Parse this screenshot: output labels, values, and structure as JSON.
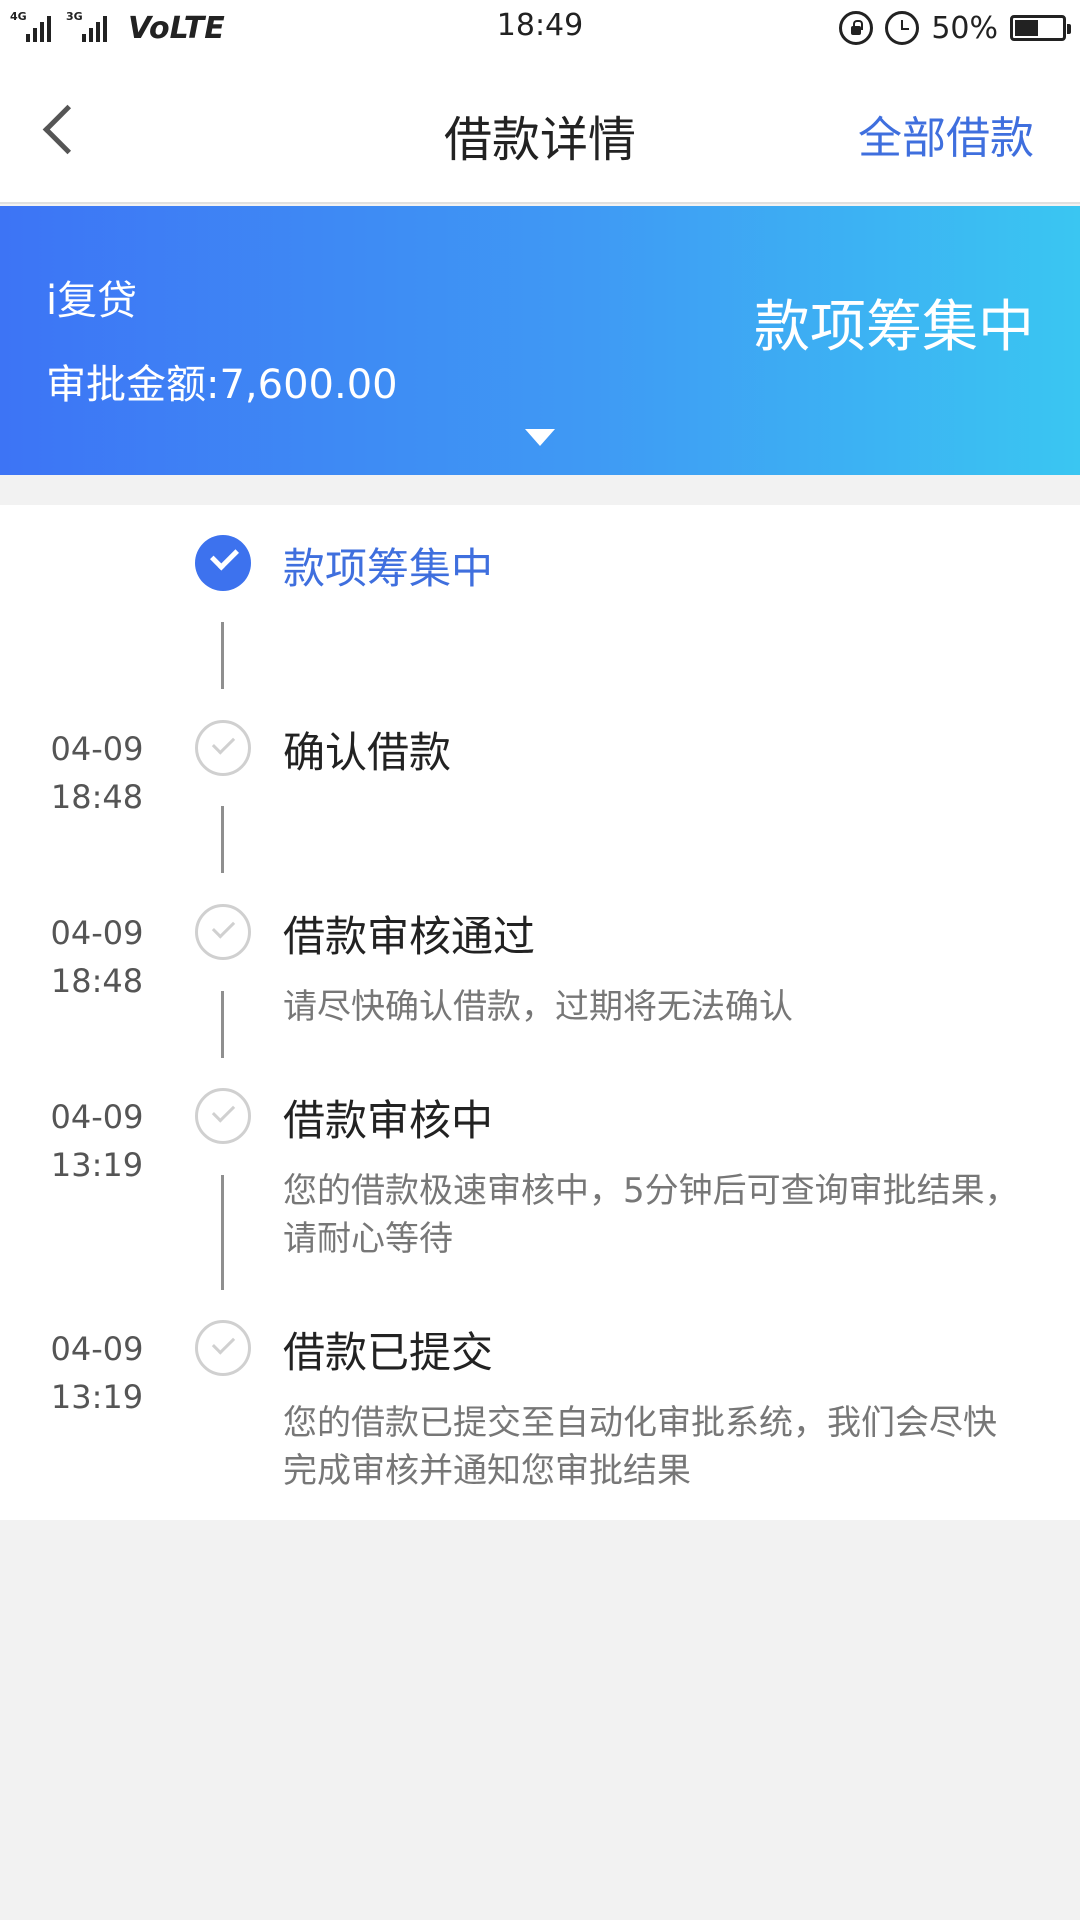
{
  "status_bar": {
    "net_4g": "4G",
    "net_3g": "3G",
    "volte": "VoLTE",
    "time": "18:49",
    "battery_percent": "50%",
    "battery_level": 0.5,
    "icons": [
      "rotation-lock-icon",
      "alarm-icon",
      "battery-icon"
    ]
  },
  "nav": {
    "title": "借款详情",
    "right_link": "全部借款",
    "back_icon": "chevron-left-icon"
  },
  "hero": {
    "product": "i复贷",
    "amount_label": "审批金额:",
    "amount": "7,600.00",
    "status": "款项筹集中",
    "expand_icon": "caret-down-icon"
  },
  "colors": {
    "accent": "#3f6fde",
    "hero_gradient_start": "#3d74f5",
    "hero_gradient_end": "#3ac6f2",
    "inactive_check": "#d0d0d0"
  },
  "timeline": [
    {
      "date": "",
      "time": "",
      "title": "款项筹集中",
      "desc": "",
      "state": "current"
    },
    {
      "date": "04-09",
      "time": "18:48",
      "title": "确认借款",
      "desc": "",
      "state": "past"
    },
    {
      "date": "04-09",
      "time": "18:48",
      "title": "借款审核通过",
      "desc": "请尽快确认借款，过期将无法确认",
      "state": "past"
    },
    {
      "date": "04-09",
      "time": "13:19",
      "title": "借款审核中",
      "desc": "您的借款极速审核中，5分钟后可查询审批结果，请耐心等待",
      "state": "past"
    },
    {
      "date": "04-09",
      "time": "13:19",
      "title": "借款已提交",
      "desc": "您的借款已提交至自动化审批系统，我们会尽快完成审核并通知您审批结果",
      "state": "past"
    }
  ]
}
